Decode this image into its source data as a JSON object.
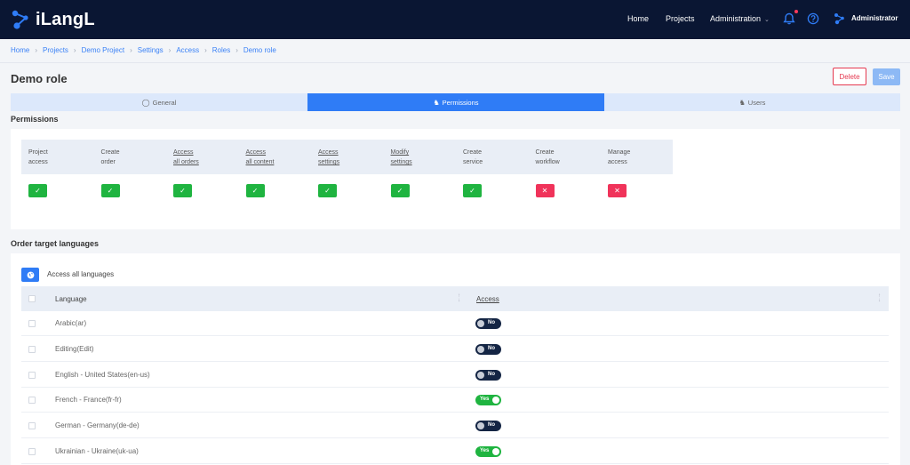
{
  "brand": {
    "name": "iLangL",
    "accent": "#2f7cf6",
    "nav_bg": "#0a1633"
  },
  "nav": {
    "home": "Home",
    "projects": "Projects",
    "administration": "Administration",
    "user": "Administrator",
    "icons": [
      "bell-icon",
      "help-icon",
      "user-icon"
    ]
  },
  "breadcrumb": [
    "Home",
    "Projects",
    "Demo Project",
    "Settings",
    "Access",
    "Roles",
    "Demo role"
  ],
  "page": {
    "title": "Demo role",
    "delete": "Delete",
    "save": "Save"
  },
  "tabs": [
    {
      "label": "General",
      "active": false
    },
    {
      "label": "Permissions",
      "active": true
    },
    {
      "label": "Users",
      "active": false
    }
  ],
  "permissions": {
    "title": "Permissions",
    "columns": [
      {
        "line1": "Project",
        "line2": "access",
        "underline": false,
        "enabled": true
      },
      {
        "line1": "Create",
        "line2": "order",
        "underline": false,
        "enabled": true
      },
      {
        "line1": "Access",
        "line2": "all orders",
        "underline": true,
        "enabled": true
      },
      {
        "line1": "Access",
        "line2": "all content",
        "underline": true,
        "enabled": true
      },
      {
        "line1": "Access",
        "line2": "settings",
        "underline": true,
        "enabled": true
      },
      {
        "line1": "Modify",
        "line2": "settings",
        "underline": true,
        "enabled": true
      },
      {
        "line1": "Create",
        "line2": "service",
        "underline": false,
        "enabled": true
      },
      {
        "line1": "Create",
        "line2": "workflow",
        "underline": false,
        "enabled": false
      },
      {
        "line1": "Manage",
        "line2": "access",
        "underline": false,
        "enabled": false
      }
    ]
  },
  "languages": {
    "title": "Order target languages",
    "access_all": "Access all languages",
    "col_language": "Language",
    "col_access": "Access",
    "rows": [
      {
        "name": "Arabic(ar)",
        "access": "No"
      },
      {
        "name": "Editing(Edit)",
        "access": "No"
      },
      {
        "name": "English - United States(en-us)",
        "access": "No"
      },
      {
        "name": "French - France(fr-fr)",
        "access": "Yes"
      },
      {
        "name": "German - Germany(de-de)",
        "access": "No"
      },
      {
        "name": "Ukrainian - Ukraine(uk-ua)",
        "access": "Yes"
      }
    ]
  }
}
